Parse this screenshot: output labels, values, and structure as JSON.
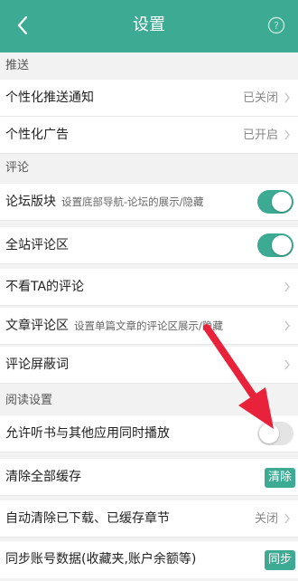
{
  "header": {
    "title": "设置",
    "back_icon": "chevron-left-icon",
    "help_icon": "question-circle-icon"
  },
  "sections": {
    "push": "推送",
    "comment": "评论",
    "reading": "阅读设置"
  },
  "push_items": {
    "personal_push": {
      "label": "个性化推送通知",
      "value": "已关闭"
    },
    "personal_ads": {
      "label": "个性化广告",
      "value": "已开启"
    }
  },
  "comment_items": {
    "forum": {
      "label": "论坛版块",
      "desc": "设置底部导航-论坛的展示/隐藏",
      "toggle": "on"
    },
    "site_comments": {
      "label": "全站评论区",
      "toggle": "on"
    },
    "hide_ta": {
      "label": "不看TA的评论"
    },
    "article_comments": {
      "label": "文章评论区",
      "desc": "设置单篇文章的评论区展示/隐藏"
    },
    "block_words": {
      "label": "评论屏蔽词"
    }
  },
  "reading_items": {
    "concurrent_audio": {
      "label": "允许听书与其他应用同时播放",
      "toggle": "off"
    },
    "clear_cache": {
      "label": "清除全部缓存",
      "button": "清除"
    },
    "auto_clear": {
      "label": "自动清除已下载、已缓存章节",
      "value": "关闭"
    },
    "sync": {
      "label": "同步账号数据(收藏夹,账户余额等)",
      "button": "同步"
    }
  },
  "colors": {
    "accent": "#3dab93",
    "arrow": "#e8223a"
  }
}
